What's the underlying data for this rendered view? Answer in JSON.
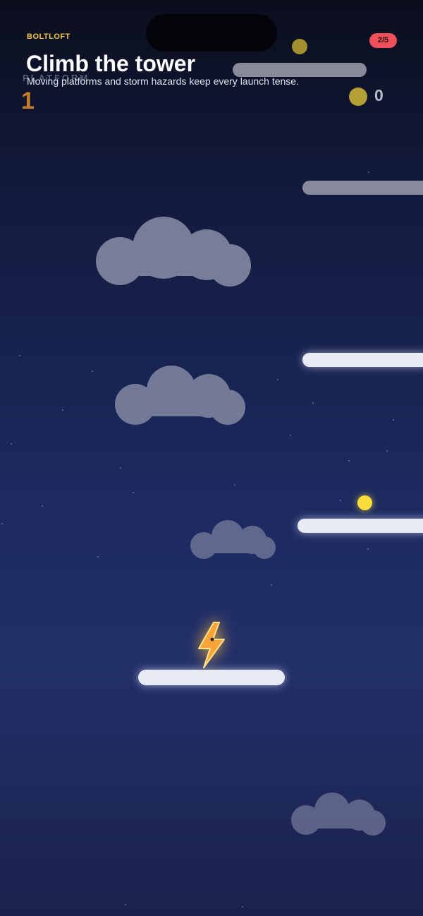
{
  "header": {
    "brand": "BOLTLOFT",
    "title": "Climb the tower",
    "subtitle": "Moving platforms and storm hazards keep every launch tense.",
    "page_indicator": "2/5"
  },
  "hud": {
    "platform_label": "PLATFORM",
    "platform_value": "1",
    "coin_count": "0",
    "coin_icon": "coin-icon"
  },
  "player": {
    "icon": "lightning-bolt-icon"
  },
  "colors": {
    "brand": "#f5c842",
    "pill": "#f0505a",
    "coin": "#f7dc3c",
    "platform": "#e8ebf6",
    "cloud": "#7d839f",
    "player_bolt": "#f7a53a"
  }
}
